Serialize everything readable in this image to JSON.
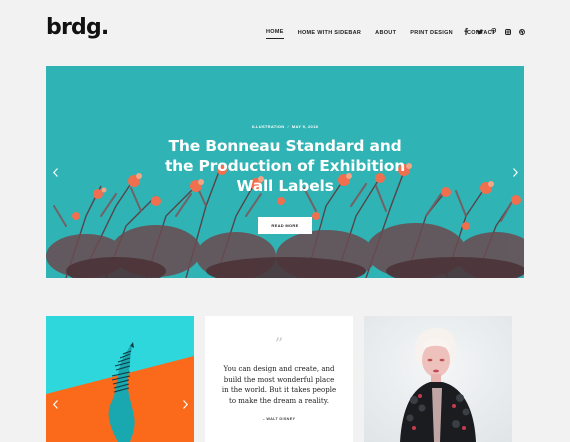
{
  "header": {
    "logo": "brdg.",
    "nav": [
      {
        "label": "HOME",
        "active": true
      },
      {
        "label": "HOME WITH SIDEBAR",
        "active": false
      },
      {
        "label": "ABOUT",
        "active": false
      },
      {
        "label": "PRINT DESIGN",
        "active": false
      },
      {
        "label": "CONTACT",
        "active": false
      }
    ],
    "social": [
      "facebook-icon",
      "twitter-icon",
      "pinterest-icon",
      "instagram-icon",
      "dribbble-icon"
    ]
  },
  "hero": {
    "category": "ILLUSTRATION",
    "date": "MAY 5, 2018",
    "title_line_1": "The Bonneau Standard and",
    "title_line_2": "the Production of Exhibition",
    "title_line_3": "Wall Labels",
    "button": "READ MORE",
    "background_color": "#2fb3b4"
  },
  "quote": {
    "mark": "”",
    "line_1": "You can design and create, and",
    "line_2": "build the most wonderful place",
    "line_3": "in the world. But it takes people",
    "line_4": "to make the dream a reality.",
    "author": "– WALT DISNEY"
  }
}
